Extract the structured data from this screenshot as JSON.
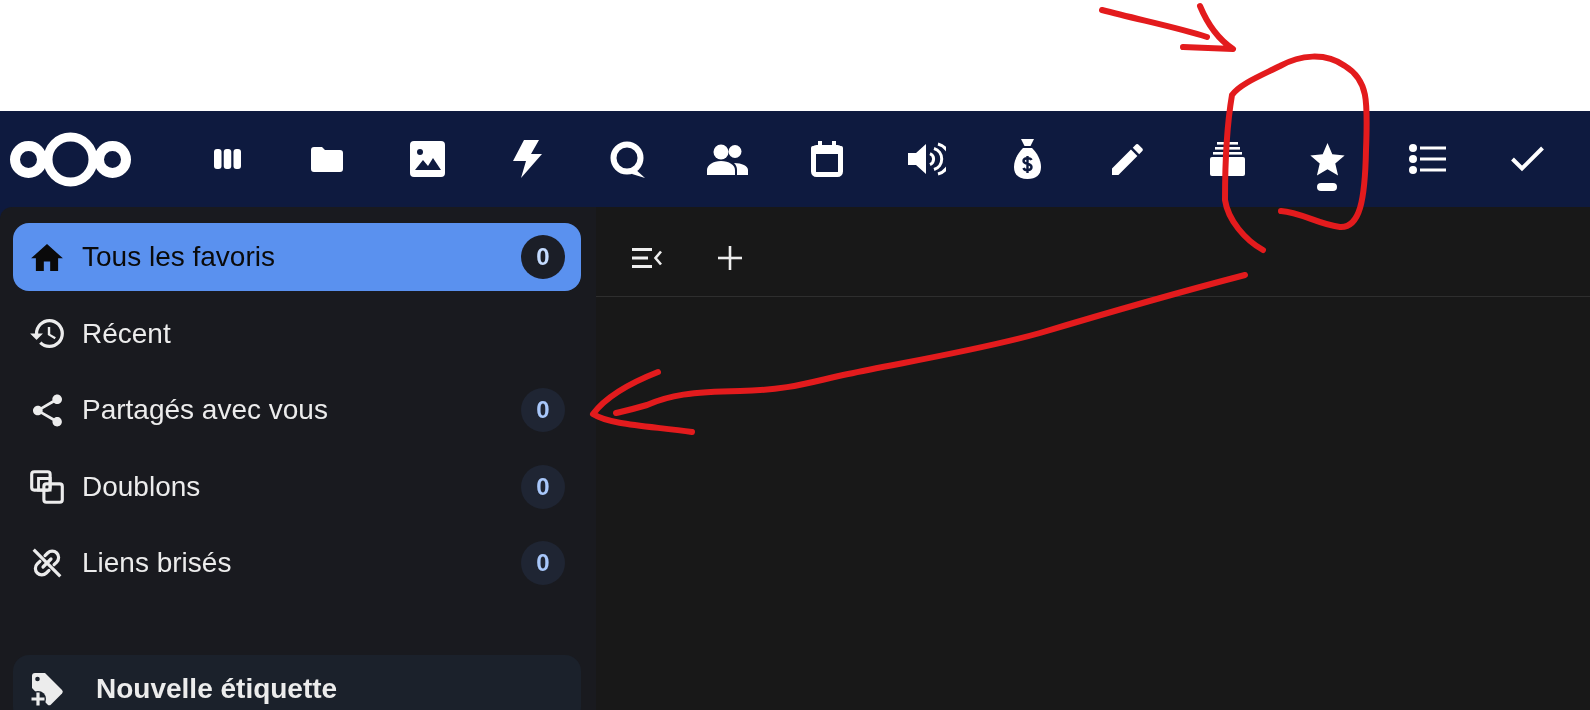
{
  "header": {
    "apps": [
      {
        "kind": "columns",
        "selected": false
      },
      {
        "kind": "folder",
        "selected": false
      },
      {
        "kind": "image",
        "selected": false
      },
      {
        "kind": "bolt",
        "selected": false
      },
      {
        "kind": "talk",
        "selected": false
      },
      {
        "kind": "people",
        "selected": false
      },
      {
        "kind": "calendar",
        "selected": false
      },
      {
        "kind": "speaker",
        "selected": false
      },
      {
        "kind": "moneybag",
        "selected": false
      },
      {
        "kind": "pencil",
        "selected": false
      },
      {
        "kind": "drawer",
        "selected": false
      },
      {
        "kind": "star",
        "selected": true
      },
      {
        "kind": "list",
        "selected": false
      },
      {
        "kind": "check",
        "selected": false
      }
    ]
  },
  "sidebar": {
    "items": [
      {
        "kind": "home",
        "label": "Tous les favoris",
        "count": "0",
        "selected": true
      },
      {
        "kind": "history",
        "label": "Récent",
        "selected": false
      },
      {
        "kind": "share",
        "label": "Partagés avec vous",
        "count": "0",
        "selected": false
      },
      {
        "kind": "duplicate",
        "label": "Doublons",
        "count": "0",
        "selected": false
      },
      {
        "kind": "unlink",
        "label": "Liens brisés",
        "count": "0",
        "selected": false
      }
    ],
    "new_tag": {
      "label": "Nouvelle étiquette"
    }
  }
}
